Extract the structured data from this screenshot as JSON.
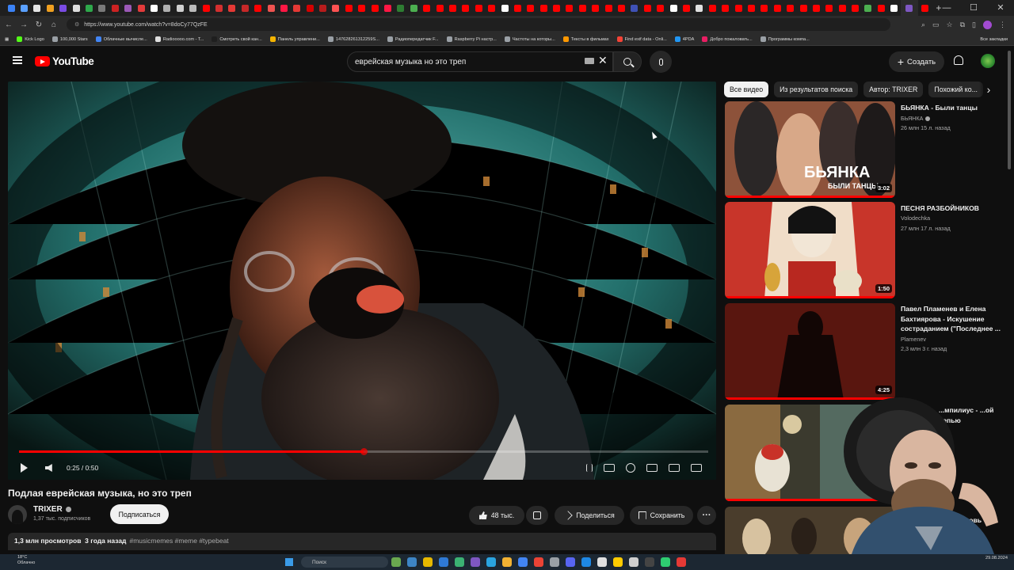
{
  "browser": {
    "url": "https://www.youtube.com/watch?v=8doCy77QzFE",
    "tab_colors": [
      "#3b82f6",
      "#5aa0ff",
      "#e5e5e5",
      "#f0a020",
      "#7a4be3",
      "#dddddd",
      "#2ea84b",
      "#7a7a7a",
      "#cc2222",
      "#9b59b6",
      "#e33b3b",
      "#ffffff",
      "#b0b0b0",
      "#cfcfcf",
      "#bbbbbb",
      "#ff0000",
      "#d32f2f",
      "#e53935",
      "#c62828",
      "#ff0000",
      "#ef5350",
      "#ff1744",
      "#e53935",
      "#d50000",
      "#b71c1c",
      "#ff5252",
      "#ff0000",
      "#ff0000",
      "#ff0000",
      "#ff1744",
      "#2e7d32",
      "#4caf50",
      "#ff0000",
      "#ff0000",
      "#ff0000",
      "#ff0000",
      "#ff0000",
      "#ff0000",
      "#ffffff",
      "#ff0000",
      "#ff0000",
      "#ff0000",
      "#ff0000",
      "#ff0000",
      "#ff0000",
      "#ff0000",
      "#ff0000",
      "#ff0000",
      "#3f51b5",
      "#ff0000",
      "#ff0000",
      "#ffffff",
      "#ff0000",
      "#e0e0e0",
      "#ff0000",
      "#ff0000",
      "#ff0000",
      "#ff0000",
      "#ff0000",
      "#ff0000",
      "#ff0000",
      "#ff0000",
      "#ff0000",
      "#ff0000",
      "#ff0000",
      "#ff0000",
      "#4caf50",
      "#ff0000",
      "#ffffff",
      "#7e57c2",
      "#ff0000"
    ],
    "bookmarks": [
      {
        "label": "Kick Logo",
        "color": "#53fc18"
      },
      {
        "label": "100,000 Stars",
        "color": "#9aa0a6"
      },
      {
        "label": "Облачные вычисле...",
        "color": "#4285f4"
      },
      {
        "label": "Radiooooo.com - T...",
        "color": "#e0e0e0"
      },
      {
        "label": "Смотреть свой кан...",
        "color": "#1f1f1f"
      },
      {
        "label": "Панель управлени...",
        "color": "#f4b400"
      },
      {
        "label": "147628261312259S...",
        "color": "#9aa0a6"
      },
      {
        "label": "Радиопередатчик F...",
        "color": "#9aa0a6"
      },
      {
        "label": "Raspberry Pi настр...",
        "color": "#9aa0a6"
      },
      {
        "label": "Частоты на которы...",
        "color": "#9aa0a6"
      },
      {
        "label": "Тексты в фильмах",
        "color": "#ff9800"
      },
      {
        "label": "Find exif data - Onli...",
        "color": "#f44336"
      },
      {
        "label": "4PDA",
        "color": "#2196f3"
      },
      {
        "label": "Добро пожаловать...",
        "color": "#e91e63"
      },
      {
        "label": "Программы компа...",
        "color": "#9aa0a6"
      }
    ],
    "all_bookmarks": "Все закладки"
  },
  "header": {
    "logo_text": "YouTube",
    "search_value": "еврейская музыка но это треп",
    "create_label": "Создать"
  },
  "player": {
    "time": "0:25 / 0:50",
    "progress": 0.5
  },
  "video": {
    "title": "Подлая еврейская музыка, но это треп",
    "channel": "TRIXER",
    "subscribers": "1,37 тыс. подписчиков",
    "subscribe_label": "Подписаться",
    "likes": "48 тыс.",
    "share_label": "Поделиться",
    "save_label": "Сохранить",
    "views": "1,3 млн просмотров",
    "age": "3 года назад",
    "tags": "#musicmemes #meme #typebeat"
  },
  "chips": [
    "Все видео",
    "Из результатов поиска",
    "Автор: TRIXER",
    "Похожий ко..."
  ],
  "recommendations": [
    {
      "title": "БЬЯНКА - Были танцы",
      "channel": "БЬЯНКА",
      "verified": true,
      "meta": "26 млн  15 л. назад",
      "duration": "3:02",
      "progress": 1.0
    },
    {
      "title": "ПЕСНЯ РАЗБОЙНИКОВ",
      "channel": "Volodechka",
      "verified": false,
      "meta": "27 млн  17 л. назад",
      "duration": "1:50",
      "progress": 1.0
    },
    {
      "title": "Павел Пламенев и Елена Бахтиярова - Искушение состраданием (\"Последнее ...",
      "channel": "Plamenev",
      "verified": false,
      "meta": "2,3 млн  3 г. назад",
      "duration": "4:25",
      "progress": 1.0
    },
    {
      "title": "...мпилиус - ...ой цепью",
      "channel": "",
      "verified": false,
      "meta": "",
      "duration": "",
      "progress": 1.0
    },
    {
      "title": "...а. Кровь",
      "channel": "",
      "verified": false,
      "meta": "",
      "duration": "",
      "progress": 0
    }
  ],
  "taskbar": {
    "weather_temp": "18°C",
    "weather_text": "Облачно",
    "search_label": "Поиск",
    "date": "29.08.2024"
  }
}
